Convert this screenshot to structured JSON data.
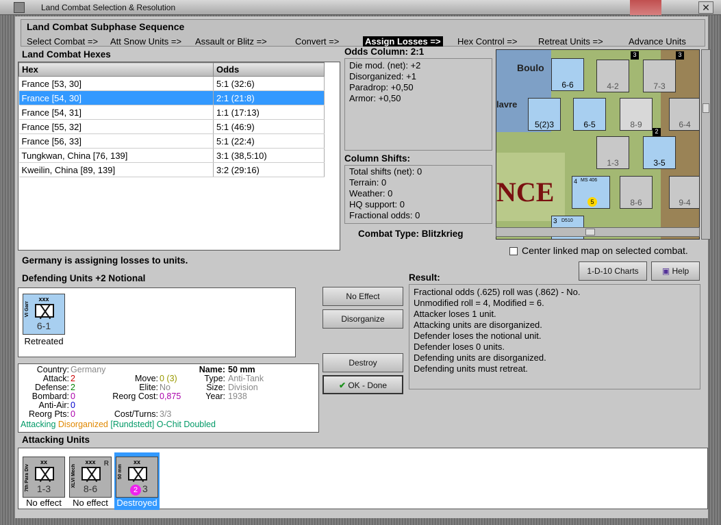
{
  "window": {
    "title": "Land Combat Selection & Resolution"
  },
  "subphase": {
    "title": "Land Combat Subphase Sequence",
    "steps": [
      "Select Combat =>",
      "Att Snow Units =>",
      "Assault or Blitz =>",
      "Convert =>",
      "Assign Losses =>",
      "Hex Control =>",
      "Retreat Units =>",
      "Advance Units"
    ],
    "active_step": "Assign Losses =>"
  },
  "hexes": {
    "title": "Land Combat Hexes",
    "columns": [
      "Hex",
      "Odds"
    ],
    "rows": [
      [
        "France [53, 30]",
        "5:1 (32:6)"
      ],
      [
        "France [54, 30]",
        "2:1 (21:8)"
      ],
      [
        "France [54, 31]",
        "1:1 (17:13)"
      ],
      [
        "France [55, 32]",
        "5:1 (46:9)"
      ],
      [
        "France [56, 33]",
        "5:1 (22:4)"
      ],
      [
        "Tungkwan, China [76, 139]",
        "3:1 (38,5:10)"
      ],
      [
        "Kweilin, China [89, 139]",
        "3:2 (29:16)"
      ]
    ],
    "selected_row": 1
  },
  "odds": {
    "title": "Odds Column: 2:1",
    "lines": [
      "Die mod. (net): +2",
      "Disorganized: +1",
      "Paradrop: +0,50",
      "Armor: +0,50"
    ]
  },
  "shifts": {
    "title": "Column Shifts:",
    "lines": [
      "Total shifts (net): 0",
      "Terrain: 0",
      "Weather: 0",
      "HQ support: 0",
      "Fractional odds: 0"
    ]
  },
  "combat_type": "Combat Type:  Blitzkrieg",
  "map": {
    "labels": {
      "city1": "Boulo",
      "city2": "lavre",
      "country": "NCE"
    },
    "units": [
      "6-6",
      "4-2",
      "7-3",
      "5(2)3",
      "6-5",
      "8-9",
      "6-4",
      "1-3",
      "3-5",
      "8-6",
      "9-4"
    ],
    "plane": {
      "name": "MS 406",
      "value": "4",
      "badge": "5"
    },
    "bottom": {
      "label": "D510",
      "value": "3"
    },
    "top_numbers": [
      "3",
      "3",
      "2"
    ]
  },
  "center_linked": {
    "label": "Center linked map on selected combat."
  },
  "status": "Germany is assigning losses to units.",
  "defending": {
    "title": "Defending Units +2 Notional",
    "units": [
      {
        "size": "xxx",
        "name": "VI Garr",
        "value": "6-1",
        "caption": "Retreated"
      }
    ]
  },
  "buttons": {
    "no_effect": "No Effect",
    "disorganize": "Disorganize",
    "destroy": "Destroy",
    "ok_done": "OK - Done",
    "charts": "1-D-10 Charts",
    "help": "Help"
  },
  "result": {
    "title": "Result:",
    "lines": [
      "Fractional odds (.625) roll was (.862)  - No.",
      "Unmodified roll = 4, Modified = 6.",
      "Attacker loses 1 unit.",
      "Attacking units are disorganized.",
      "Defender loses the notional unit.",
      "Defender loses 0 units.",
      "Defending units are disorganized.",
      "Defending units must retreat."
    ]
  },
  "details": {
    "country_label": "Country:",
    "country": "Germany",
    "attack_label": "Attack:",
    "attack": "2",
    "defense_label": "Defense:",
    "defense": "2",
    "bombard_label": "Bombard:",
    "bombard": "0",
    "antiair_label": "Anti-Air:",
    "antiair": "0",
    "reorgpts_label": "Reorg Pts:",
    "reorgpts": "0",
    "move_label": "Move:",
    "move": "0 (3)",
    "elite_label": "Elite:",
    "elite": "No",
    "reorgcost_label": "Reorg Cost:",
    "reorgcost": "0,875",
    "costturns_label": "Cost/Turns:",
    "costturns": "3/3",
    "name_label": "Name:",
    "name": "50 mm",
    "type_label": "Type:",
    "type": "Anti-Tank",
    "size_label": "Size:",
    "size": "Division",
    "year_label": "Year:",
    "year": "1938",
    "status_attacking": "Attacking",
    "status_disorganized": "Disorganized",
    "status_leader": "[Rundstedt]",
    "status_ochit": "O-Chit Doubled"
  },
  "attacking": {
    "title": "Attacking Units",
    "units": [
      {
        "size": "xx",
        "name": "7th Para Div",
        "value": "1-3",
        "caption": "No effect"
      },
      {
        "size": "xxx",
        "name": "XLVI Mech",
        "value": "8-6",
        "caption": "No effect",
        "badge": "R"
      },
      {
        "size": "xx",
        "name": "50 mm",
        "value": "3",
        "dot": "2",
        "caption": "Destroyed"
      }
    ]
  },
  "colors": {
    "selection": "#3399ff",
    "attack_value": "#cc0000",
    "defense_value": "#008000",
    "bombard_value": "#aa00aa",
    "move_value": "#999900",
    "status_green": "#009966",
    "status_orange": "#e08800"
  }
}
